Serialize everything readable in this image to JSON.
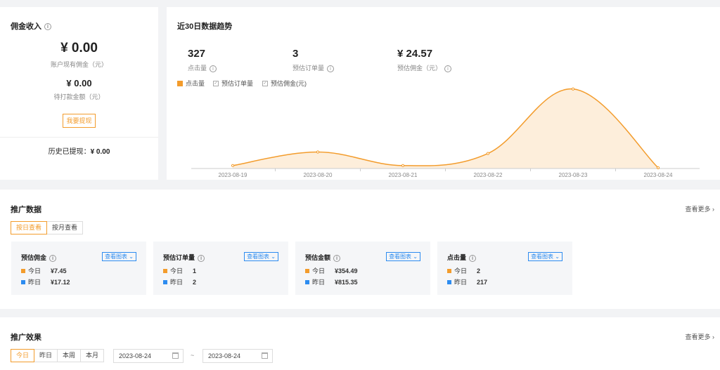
{
  "commission": {
    "title": "佣金收入",
    "balance": "¥ 0.00",
    "balance_label": "账户现有佣金（元）",
    "pending": "¥ 0.00",
    "pending_label": "待打款金额（元）",
    "withdraw_label": "我要提现",
    "history_label": "历史已提现：",
    "history_value": "¥ 0.00"
  },
  "trend": {
    "title": "近30日数据趋势",
    "stats": [
      {
        "value": "327",
        "label": "点击量"
      },
      {
        "value": "3",
        "label": "预估订单量"
      },
      {
        "value": "¥ 24.57",
        "label": "预估佣金（元）"
      }
    ],
    "legend": [
      {
        "label": "点击量",
        "selected": true
      },
      {
        "label": "预估订单量",
        "selected": false
      },
      {
        "label": "预估佣金(元)",
        "selected": false
      }
    ]
  },
  "chart_data": {
    "type": "area",
    "categories": [
      "2023-08-19",
      "2023-08-20",
      "2023-08-21",
      "2023-08-22",
      "2023-08-23",
      "2023-08-24"
    ],
    "series": [
      {
        "name": "点击量",
        "values": [
          8,
          45,
          8,
          41,
          217,
          2
        ]
      }
    ],
    "ylim": [
      0,
      230
    ],
    "grid": false,
    "color": "#f39c2c",
    "fill": "#fdeedb"
  },
  "promo": {
    "title": "推广数据",
    "more": "查看更多",
    "tabs": [
      "按日查看",
      "按月查看"
    ],
    "today_label": "今日",
    "yesterday_label": "昨日",
    "view_chart": "查看图表",
    "cards": [
      {
        "title": "预估佣金",
        "today": "¥7.45",
        "yesterday": "¥17.12"
      },
      {
        "title": "预估订单量",
        "today": "1",
        "yesterday": "2"
      },
      {
        "title": "预估金额",
        "today": "¥354.49",
        "yesterday": "¥815.35"
      },
      {
        "title": "点击量",
        "today": "2",
        "yesterday": "217"
      }
    ]
  },
  "effect": {
    "title": "推广效果",
    "more": "查看更多",
    "tabs": [
      "今日",
      "昨日",
      "本周",
      "本月"
    ],
    "date_start": "2023-08-24",
    "date_end": "2023-08-24",
    "date_sep": "~"
  },
  "colors": {
    "accent": "#f39c2c",
    "blue": "#2d8cf0"
  }
}
